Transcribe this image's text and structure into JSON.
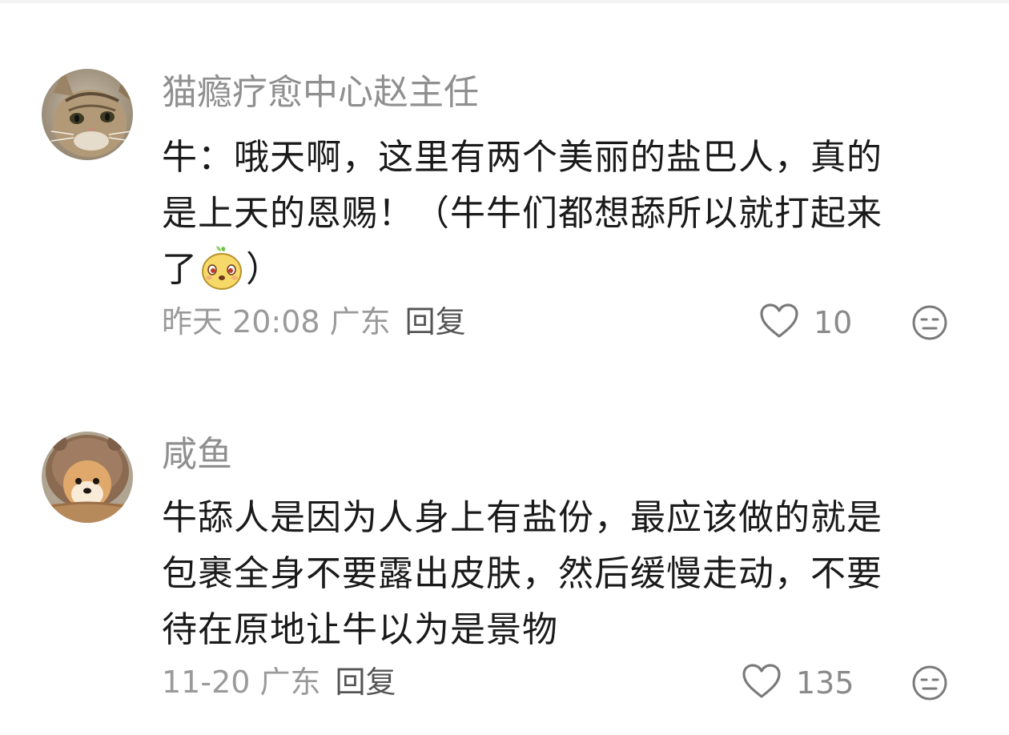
{
  "comments": [
    {
      "avatar_icon": "cat-avatar",
      "username": "猫瘾疗愈中心赵主任",
      "content_lines": [
        "牛：哦天啊，这里有两个美丽的盐巴人，真的",
        "是上天的恩赐！（牛牛们都想舔所以就打起来",
        "了"
      ],
      "content_tail": "）",
      "emoji_icon": "cute-face-emoji",
      "meta_time_location": "昨天 20:08 广东",
      "reply_label": "回复",
      "like_count": "10",
      "like_icon": "heart-outline-icon",
      "dislike_icon": "meh-face-icon"
    },
    {
      "avatar_icon": "shiba-dog-avatar",
      "username": "咸鱼",
      "content_lines": [
        "牛舔人是因为人身上有盐份，最应该做的就是",
        "包裹全身不要露出皮肤，然后缓慢走动，不要",
        "待在原地让牛以为是景物"
      ],
      "meta_time_location": "11-20 广东",
      "reply_label": "回复",
      "like_count": "135",
      "like_icon": "heart-outline-icon",
      "dislike_icon": "meh-face-icon"
    }
  ],
  "colors": {
    "username": "#8f8f8f",
    "content": "#1a1a1a",
    "meta": "#9a9a9a",
    "reply": "#555555",
    "icon": "#7a7a7a"
  }
}
